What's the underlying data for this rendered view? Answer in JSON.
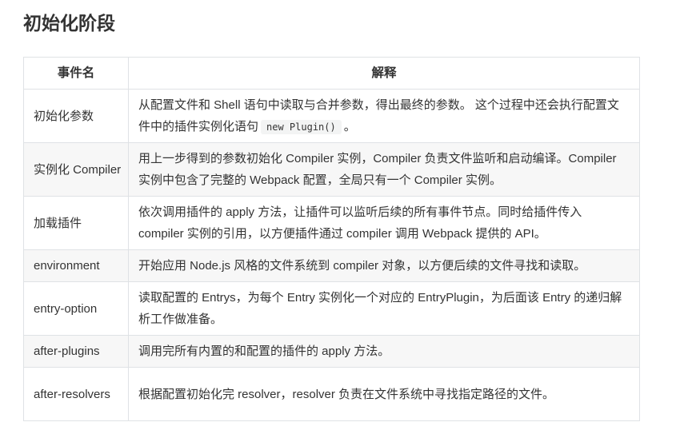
{
  "page": {
    "title": "初始化阶段"
  },
  "table": {
    "headers": [
      "事件名",
      "解释"
    ],
    "rows": [
      {
        "name": "初始化参数",
        "desc_before": "从配置文件和 Shell 语句中读取与合并参数，得出最终的参数。 这个过程中还会执行配置文件中的插件实例化语句",
        "desc_code": "new Plugin()",
        "desc_after": "。"
      },
      {
        "name": "实例化 Compiler",
        "desc": "用上一步得到的参数初始化 Compiler 实例，Compiler 负责文件监听和启动编译。Compiler 实例中包含了完整的 Webpack 配置，全局只有一个 Compiler 实例。"
      },
      {
        "name": "加载插件",
        "desc": "依次调用插件的 apply 方法，让插件可以监听后续的所有事件节点。同时给插件传入 compiler 实例的引用，以方便插件通过 compiler 调用 Webpack 提供的 API。"
      },
      {
        "name": "environment",
        "desc": "开始应用 Node.js 风格的文件系统到 compiler 对象，以方便后续的文件寻找和读取。"
      },
      {
        "name": "entry-option",
        "desc": "读取配置的 Entrys，为每个 Entry 实例化一个对应的 EntryPlugin，为后面该 Entry 的递归解析工作做准备。"
      },
      {
        "name": "after-plugins",
        "desc": "调用完所有内置的和配置的插件的 apply 方法。"
      },
      {
        "name": "after-resolvers",
        "desc": "根据配置初始化完 resolver，resolver 负责在文件系统中寻找指定路径的文件。"
      }
    ]
  }
}
